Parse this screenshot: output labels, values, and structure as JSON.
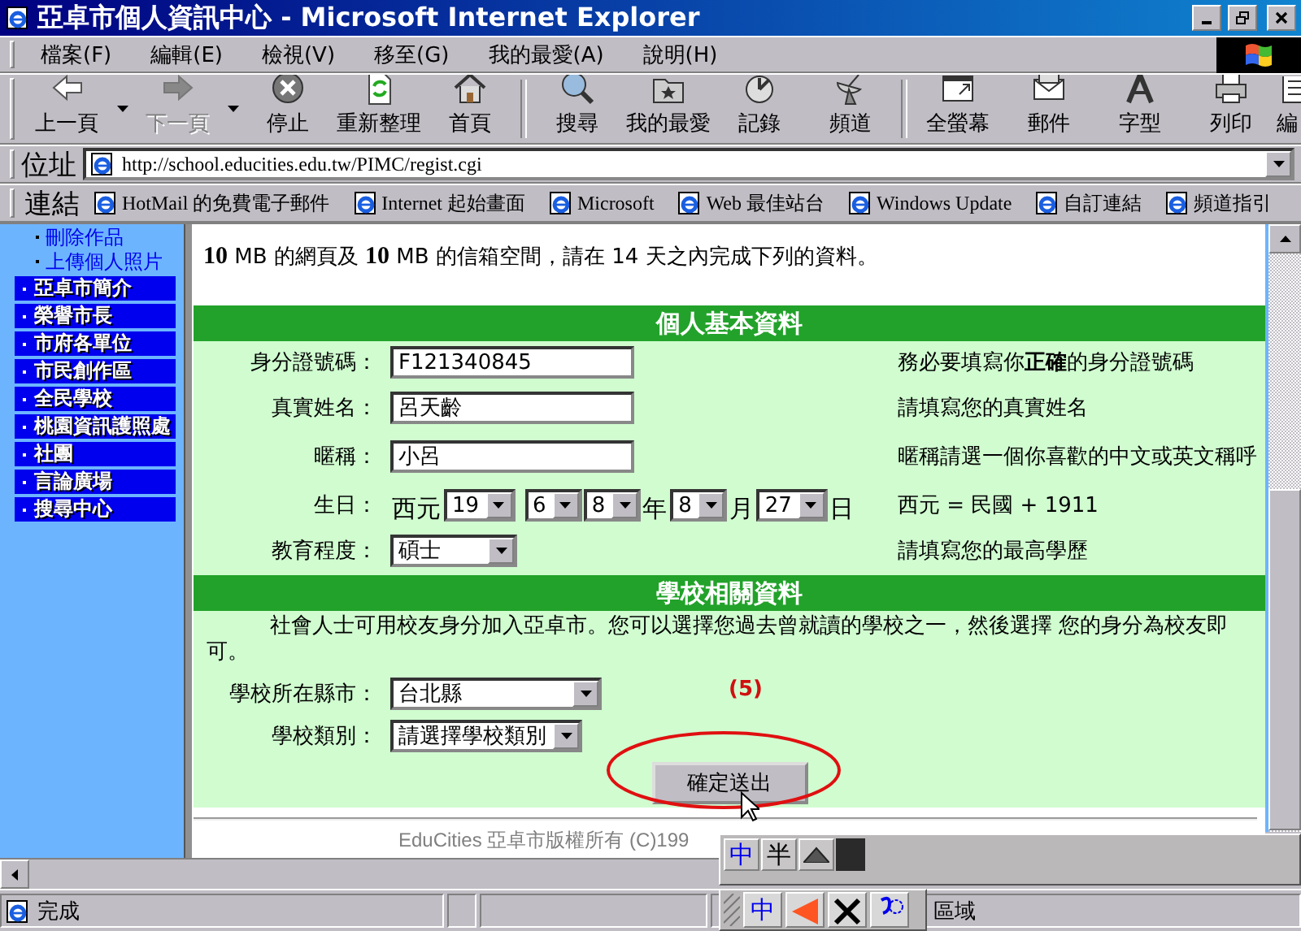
{
  "window": {
    "title": "亞卓市個人資訊中心 - Microsoft Internet Explorer"
  },
  "menu": [
    "檔案(F)",
    "編輯(E)",
    "檢視(V)",
    "移至(G)",
    "我的最愛(A)",
    "說明(H)"
  ],
  "toolbar": [
    {
      "label": "上一頁",
      "disabled": false,
      "dropdown": true
    },
    {
      "label": "下一頁",
      "disabled": true,
      "dropdown": true
    },
    {
      "label": "停止",
      "disabled": false,
      "dropdown": false
    },
    {
      "label": "重新整理",
      "disabled": false,
      "dropdown": false
    },
    {
      "label": "首頁",
      "disabled": false,
      "dropdown": false
    },
    {
      "label": "搜尋",
      "disabled": false,
      "dropdown": false
    },
    {
      "label": "我的最愛",
      "disabled": false,
      "dropdown": false
    },
    {
      "label": "記錄",
      "disabled": false,
      "dropdown": false
    },
    {
      "label": "頻道",
      "disabled": false,
      "dropdown": false
    },
    {
      "label": "全螢幕",
      "disabled": false,
      "dropdown": false
    },
    {
      "label": "郵件",
      "disabled": false,
      "dropdown": false
    },
    {
      "label": "字型",
      "disabled": false,
      "dropdown": false
    },
    {
      "label": "列印",
      "disabled": false,
      "dropdown": false
    },
    {
      "label": "編",
      "disabled": false,
      "dropdown": false
    }
  ],
  "address": {
    "label": "位址",
    "value": "http://school.educities.edu.tw/PIMC/regist.cgi"
  },
  "links": {
    "label": "連結",
    "items": [
      "HotMail 的免費電子郵件",
      "Internet 起始畫面",
      "Microsoft",
      "Web 最佳站台",
      "Windows Update",
      "自訂連結",
      "頻道指引"
    ]
  },
  "sidebar": {
    "sublinks": [
      "刪除作品",
      "上傳個人照片"
    ],
    "items": [
      "亞卓市簡介",
      "榮譽市長",
      "市府各單位",
      "市民創作區",
      "全民學校",
      "桃園資訊護照處",
      "社團",
      "言論廣場",
      "搜尋中心"
    ]
  },
  "intro": "**10** MB 的網頁及 **10** MB 的信箱空間，請在 14 天之內完成下列的資料。",
  "sections": [
    {
      "title": "個人基本資料",
      "fields": [
        {
          "label": "身分證號碼：",
          "kind": "text",
          "value": "F121340845",
          "hint": "務必要填寫你**正確**的身分證號碼"
        },
        {
          "label": "真實姓名：",
          "kind": "text",
          "value": "呂天齡",
          "hint": "請填寫您的真實姓名"
        },
        {
          "label": "暱稱：",
          "kind": "text",
          "value": "小呂",
          "hint": "暱稱請選一個你喜歡的中文或英文稱呼"
        },
        {
          "label": "生日：",
          "kind": "date",
          "parts": [
            {
              "kind": "text",
              "text": "西元"
            },
            {
              "kind": "select",
              "value": "19"
            },
            {
              "kind": "select",
              "value": "6"
            },
            {
              "kind": "select",
              "value": "8"
            },
            {
              "kind": "text",
              "text": "年"
            },
            {
              "kind": "select",
              "value": "8"
            },
            {
              "kind": "text",
              "text": "月"
            },
            {
              "kind": "select",
              "value": "27"
            },
            {
              "kind": "text",
              "text": "日"
            }
          ],
          "hint": "西元 = 民國 + 1911"
        },
        {
          "label": "教育程度：",
          "kind": "select",
          "value": "碩士",
          "hint": "請填寫您的最高學歷"
        }
      ]
    },
    {
      "title": "學校相關資料",
      "note": "社會人士可用校友身分加入亞卓市。您可以選擇您過去曾就讀的學校之一，然後選擇 您的身分為校友即可。",
      "fields": [
        {
          "label": "學校所在縣市：",
          "kind": "select",
          "value": "台北縣"
        },
        {
          "label": "學校類別：",
          "kind": "select",
          "value": "請選擇學校類別"
        }
      ]
    }
  ],
  "annotation": "(5)",
  "submit": "確定送出",
  "footer": "EduCities 亞卓市版權所有 (C)199",
  "status": {
    "text": "完成",
    "zone": "區域"
  },
  "ime": {
    "buttons": [
      "中",
      "半"
    ],
    "tray": [
      "中"
    ]
  }
}
